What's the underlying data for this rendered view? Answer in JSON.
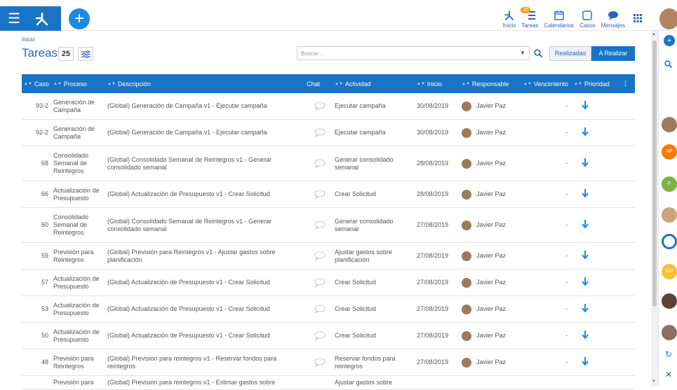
{
  "nav": {
    "items": [
      {
        "label": "Inicio",
        "icon": "inicio-icon"
      },
      {
        "label": "Tareas",
        "icon": "tareas-icon",
        "badge": "25"
      },
      {
        "label": "Calendarios",
        "icon": "calendar-icon"
      },
      {
        "label": "Casos",
        "icon": "casos-icon"
      },
      {
        "label": "Mensajes",
        "icon": "chat-bubble-icon"
      }
    ]
  },
  "page": {
    "breadcrumb": "Inicio",
    "title": "Tareas",
    "count": "25",
    "search_placeholder": "Buscar ...",
    "tab_done": "Realizadas",
    "tab_todo": "A Realizar"
  },
  "table": {
    "headers": [
      "Caso",
      "Proceso",
      "Descripción",
      "Chat",
      "Actividad",
      "Inicio",
      "Responsable",
      "Vencimiento",
      "Prioridad"
    ],
    "rows": [
      {
        "caso": "93-2",
        "proceso": "Generación de Campaña",
        "descripcion": "(Global) Generación de Campaña v1 - Ejecutar campaña",
        "actividad": "Ejecutar campaña",
        "inicio": "30/08/2019",
        "responsable": "Javier Paz",
        "vencimiento": "-"
      },
      {
        "caso": "92-2",
        "proceso": "Generación de Campaña",
        "descripcion": "(Global) Generación de Campaña v1 - Ejecutar campaña",
        "actividad": "Ejecutar campaña",
        "inicio": "30/08/2019",
        "responsable": "Javier Paz",
        "vencimiento": "-"
      },
      {
        "caso": "68",
        "proceso": "Consolidado Semanal de Reintegros",
        "descripcion": "(Global) Consolidado Semanal de Reintegros v1 - Generar consolidado semanal",
        "actividad": "Generar consolidado semanal",
        "inicio": "28/08/2019",
        "responsable": "Javier Paz",
        "vencimiento": "-"
      },
      {
        "caso": "66",
        "proceso": "Actualización de Presupuesto",
        "descripcion": "(Global) Actualización de Presupuesto v1 - Crear Solicitud",
        "actividad": "Crear Solicitud",
        "inicio": "28/08/2019",
        "responsable": "Javier Paz",
        "vencimiento": "-"
      },
      {
        "caso": "60",
        "proceso": "Consolidado Semanal de Reintegros",
        "descripcion": "(Global) Consolidado Semanal de Reintegros v1 - Generar consolidado semanal",
        "actividad": "Generar consolidado semanal",
        "inicio": "27/08/2019",
        "responsable": "Javier Paz",
        "vencimiento": "-"
      },
      {
        "caso": "59",
        "proceso": "Previsión para Reintegros",
        "descripcion": "(Global) Previsión para Reintegros v1 - Ajustar gastos sobre planificación",
        "actividad": "Ajustar gastos sobre planificación",
        "inicio": "27/08/2019",
        "responsable": "Javier Paz",
        "vencimiento": "-"
      },
      {
        "caso": "57",
        "proceso": "Actualización de Presupuesto",
        "descripcion": "(Global) Actualización de Presupuesto v1 - Crear Solicitud",
        "actividad": "Crear Solicitud",
        "inicio": "27/08/2019",
        "responsable": "Javier Paz",
        "vencimiento": "-"
      },
      {
        "caso": "53",
        "proceso": "Actualización de Presupuesto",
        "descripcion": "(Global) Actualización de Presupuesto v1 - Crear Solicitud",
        "actividad": "Crear Solicitud",
        "inicio": "27/08/2019",
        "responsable": "Javier Paz",
        "vencimiento": "-"
      },
      {
        "caso": "50",
        "proceso": "Actualización de Presupuesto",
        "descripcion": "(Global) Actualización de Presupuesto v1 - Crear Solicitud",
        "actividad": "Crear Solicitud",
        "inicio": "27/08/2019",
        "responsable": "Javier Paz",
        "vencimiento": "-"
      },
      {
        "caso": "48",
        "proceso": "Previsión para Reintegros",
        "descripcion": "(Global) Prevision para reintegros v1 - Reservar fondos para reintegros",
        "actividad": "Reservar fondos para reintegros",
        "inicio": "27/08/2019",
        "responsable": "Javier Paz",
        "vencimiento": "-"
      },
      {
        "caso": "",
        "proceso": "Previsión para",
        "descripcion": "(Global) Prevision para reintegros v1 - Estimar gastos sobre",
        "actividad": "Ajustar gastos sobre",
        "inicio": "",
        "responsable": "",
        "vencimiento": ""
      }
    ]
  },
  "rightbar": {
    "avatars": [
      {
        "initials": "AP",
        "color": "#f57c00"
      },
      {
        "initials": "F",
        "color": "#7cb342"
      },
      {
        "initials": "GD",
        "color": "#fbc02d"
      }
    ]
  },
  "colors": {
    "primary": "#1a73c4",
    "priority_arrow": "#1e88e5"
  }
}
